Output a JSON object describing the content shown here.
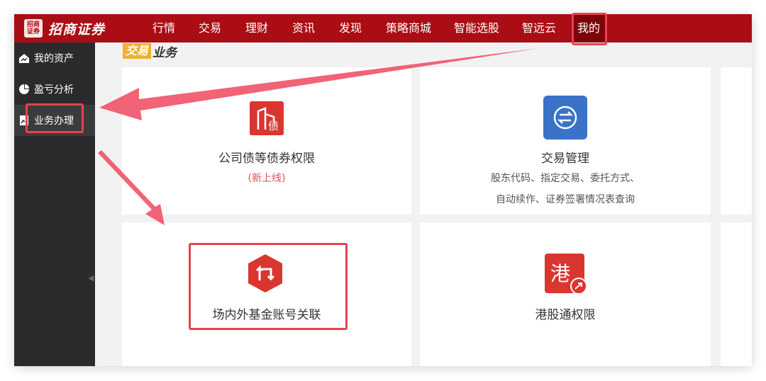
{
  "app": {
    "logo_mark": "招商证券",
    "logo_text": "招商证券"
  },
  "topnav": {
    "items": [
      "行情",
      "交易",
      "理财",
      "资讯",
      "发现",
      "策略商城",
      "智能选股",
      "智远云",
      "我的"
    ],
    "active_index": 8
  },
  "sidebar": {
    "items": [
      {
        "label": "我的资产",
        "icon": "home-chart-icon"
      },
      {
        "label": "盈亏分析",
        "icon": "pie-chart-icon"
      },
      {
        "label": "业务办理",
        "icon": "document-icon"
      }
    ],
    "active_index": 2,
    "collapse_glyph": "◀"
  },
  "section": {
    "tag": "交易",
    "rest": "业务"
  },
  "cards": [
    {
      "title": "公司债等债券权限",
      "subtitle": "(新上线)",
      "icon": "bond-building-icon",
      "icon_char": "债"
    },
    {
      "title": "交易管理",
      "subtitle_lines": [
        "股东代码、指定交易、委托方式、",
        "自动续作、证券签署情况表查询"
      ],
      "icon": "exchange-arrows-icon"
    },
    {
      "title": "场内外基金账号关联",
      "icon": "link-arrows-icon"
    },
    {
      "title": "港股通权限",
      "icon": "hk-connect-icon",
      "icon_char": "港"
    }
  ],
  "colors": {
    "brand_red": "#ab0d14",
    "annotation_red": "#e8414f",
    "subtitle_red": "#d9534f",
    "icon_blue": "#3a72c8",
    "icon_red": "#d9362f",
    "section_tag": "#f0b033",
    "sidebar_bg": "#2b2b2d"
  }
}
